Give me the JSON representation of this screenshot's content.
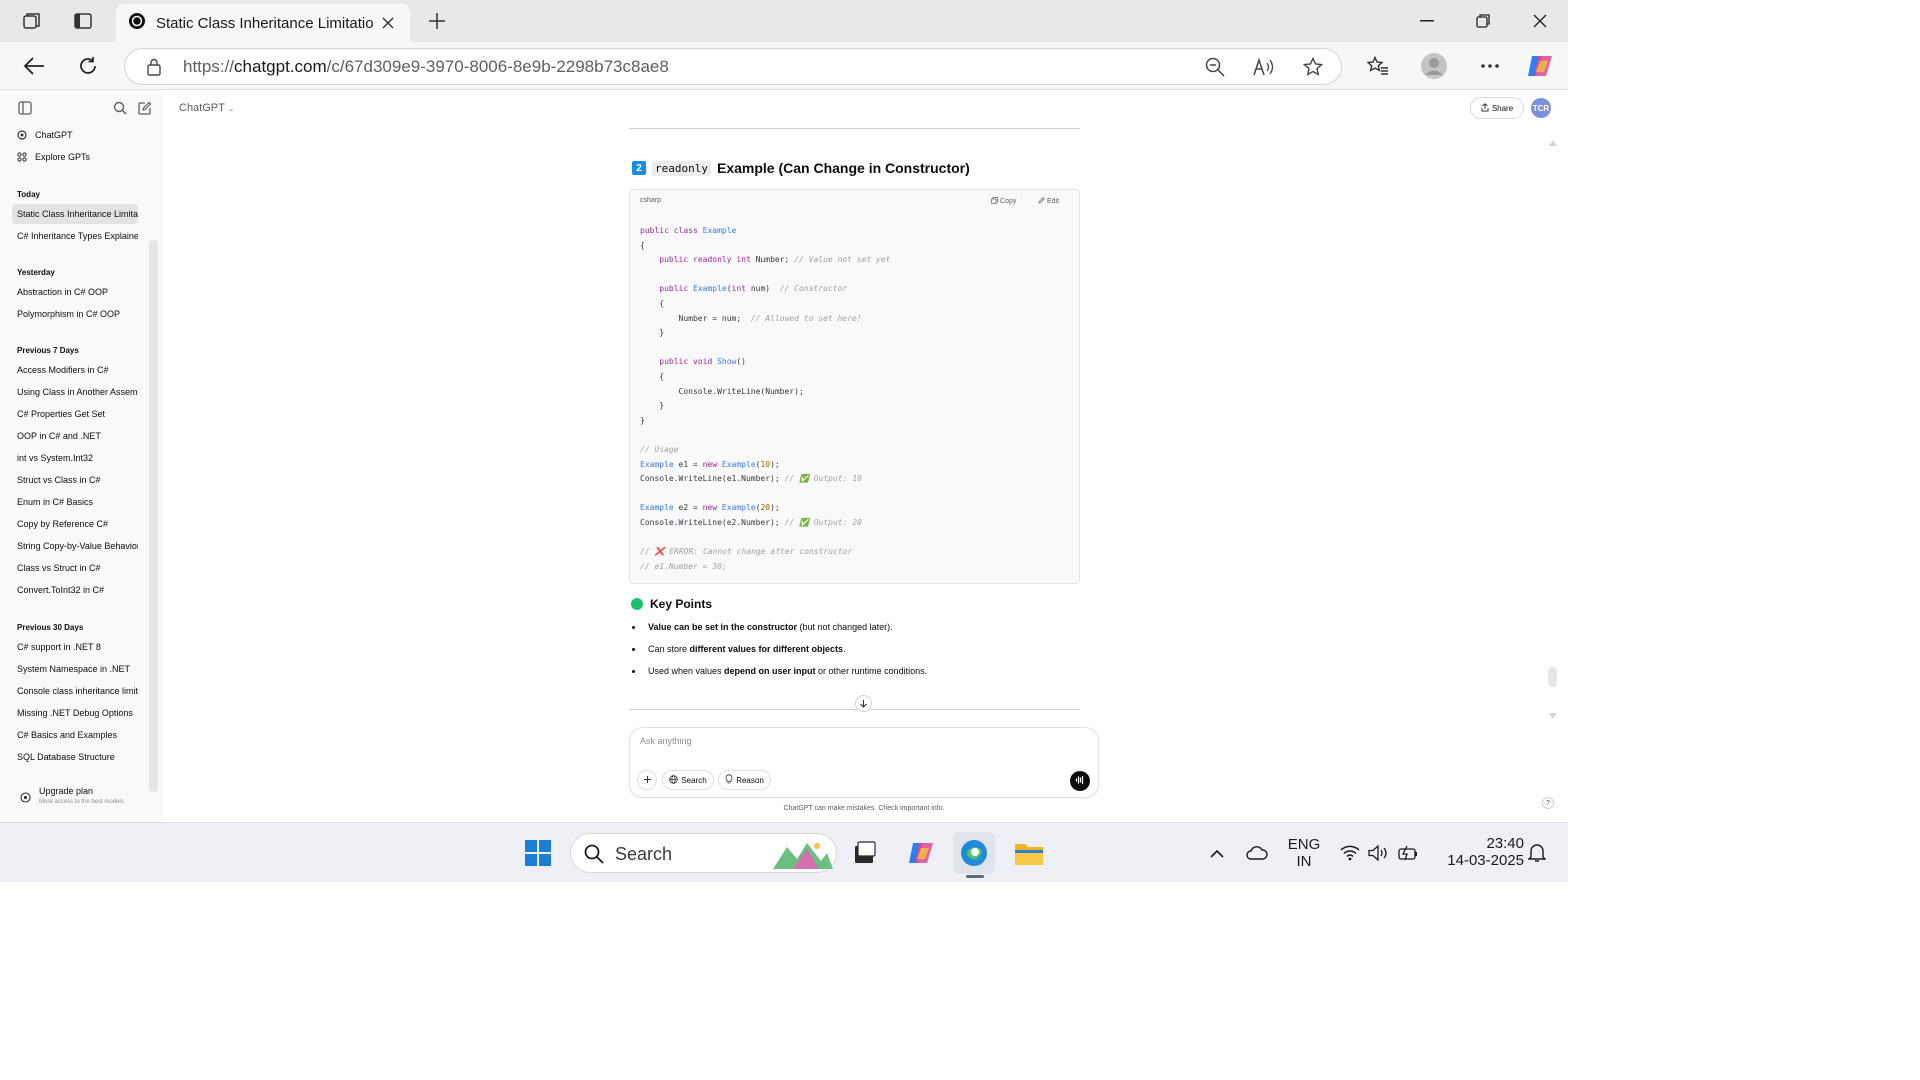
{
  "browser": {
    "tab_title": "Static Class Inheritance Limitation",
    "url_scheme": "https://",
    "url_host": "chatgpt.com",
    "url_path": "/c/67d309e9-3970-8006-8e9b-2298b73c8ae8"
  },
  "sidebar": {
    "top_items": [
      {
        "label": "ChatGPT",
        "icon": "chatgpt-logo-icon"
      },
      {
        "label": "Explore GPTs",
        "icon": "grid-icon"
      }
    ],
    "sections": [
      {
        "heading": "Today",
        "items": [
          "Static Class Inheritance Limitation",
          "C# Inheritance Types Explained"
        ]
      },
      {
        "heading": "Yesterday",
        "items": [
          "Abstraction in C# OOP",
          "Polymorphism in C# OOP"
        ]
      },
      {
        "heading": "Previous 7 Days",
        "items": [
          "Access Modifiers in C#",
          "Using Class in Another Assembly",
          "C# Properties Get Set",
          "OOP in C# and .NET",
          "int vs System.Int32",
          "Struct vs Class in C#",
          "Enum in C# Basics",
          "Copy by Reference C#",
          "String Copy-by-Value Behavior",
          "Class vs Struct in C#",
          "Convert.ToInt32 in C#"
        ]
      },
      {
        "heading": "Previous 30 Days",
        "items": [
          "C# support in .NET 8",
          "System Namespace in .NET",
          "Console class inheritance limits",
          "Missing .NET Debug Options",
          "C# Basics and Examples",
          "SQL Database Structure"
        ]
      }
    ],
    "upgrade": {
      "title": "Upgrade plan",
      "subtitle": "More access to the best models"
    }
  },
  "header": {
    "model": "ChatGPT",
    "share_label": "Share",
    "avatar_initials": "TCR"
  },
  "content": {
    "section_number": "2",
    "heading_code": "readonly",
    "heading_text": "Example (Can Change in Constructor)",
    "code_language": "csharp",
    "copy_label": "Copy",
    "edit_label": "Edit",
    "code_lines": [
      "public class Example",
      "{",
      "    public readonly int Number; // Value not set yet",
      "",
      "    public Example(int num)  // Constructor",
      "    {",
      "        Number = num;  // Allowed to set here!",
      "    }",
      "",
      "    public void Show()",
      "    {",
      "        Console.WriteLine(Number);",
      "    }",
      "}",
      "",
      "// Usage",
      "Example e1 = new Example(10);",
      "Console.WriteLine(e1.Number); // ✅ Output: 10",
      "",
      "Example e2 = new Example(20);",
      "Console.WriteLine(e2.Number); // ✅ Output: 20",
      "",
      "// ❌ ERROR: Cannot change after constructor",
      "// e1.Number = 30;"
    ],
    "key_points_heading": "Key Points",
    "key_points": [
      {
        "bold": "Value can be set in the constructor",
        "rest": " (but not changed later)."
      },
      {
        "pre": "Can store ",
        "bold": "different values for different objects",
        "rest": "."
      },
      {
        "pre": "Used when values ",
        "bold": "depend on user input",
        "rest": " or other runtime conditions."
      }
    ]
  },
  "composer": {
    "placeholder": "Ask anything",
    "search_label": "Search",
    "reason_label": "Reason",
    "disclaimer": "ChatGPT can make mistakes. Check important info."
  },
  "taskbar": {
    "search_placeholder": "Search",
    "language_top": "ENG",
    "language_bottom": "IN",
    "time": "23:40",
    "date": "14-03-2025"
  },
  "colors": {
    "accent_badge": "#1a8fe0",
    "key_points_dot": "#1fbf6b",
    "voice_button": "#0d0d0d"
  }
}
